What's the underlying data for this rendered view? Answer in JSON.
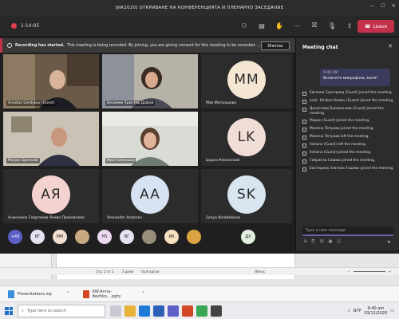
{
  "window": {
    "title": "[ИК2020] ОТКРИВАНЕ НА КОНФЕРЕНЦИЯТА И ПЛЕНАРНО ЗАСЕДАНИЕ"
  },
  "toolbar": {
    "timer": "1:14:05",
    "leave_label": "Leave"
  },
  "notice": {
    "bold": "Recording has started.",
    "text": "This meeting is being recorded. By joining, you are giving consent for this meeting to be recorded. ...",
    "dismiss_label": "Dismiss"
  },
  "tiles": [
    {
      "name": "Anastas Gerdjikov (Guest)"
    },
    {
      "name": "Весиеми Христов Дафов"
    },
    {
      "name": "Мая Митрашева",
      "initials": "MM",
      "color": "#f5e6d3"
    },
    {
      "name": "Marjan Gjurovski"
    },
    {
      "name": "Мил Сипонька"
    },
    {
      "name": "Църко Кеннеский",
      "initials": "LK",
      "color": "#f0ddd6"
    },
    {
      "name": "Анжелина Георгиева Янева Проковлева",
      "initials": "АЯ",
      "color": "#f3d2cf"
    },
    {
      "name": "Alexander Andonov",
      "initials": "AA",
      "color": "#d7e3f2"
    },
    {
      "name": "Sonya Karabelkova",
      "initials": "SK",
      "color": "#d8e5f0"
    }
  ],
  "strip": [
    {
      "label": "+40",
      "color": "#5b5fc7"
    },
    {
      "label": "ВГ",
      "color": "#e3e3f3"
    },
    {
      "label": "ММ",
      "color": "#f1dfd1"
    },
    {
      "label": "",
      "color": "#c9a882"
    },
    {
      "label": "HS",
      "color": "#ecd9f0"
    },
    {
      "label": "ВГ",
      "color": "#e3e3f3"
    },
    {
      "label": "",
      "color": "#9a8d7a"
    },
    {
      "label": "ИК",
      "color": "#f7e0bf"
    },
    {
      "label": "",
      "color": "#d9a441"
    },
    {
      "label": "ДХ",
      "color": "#e2efde"
    }
  ],
  "chat": {
    "title": "Meeting chat",
    "bubble_time": "9:40 AM",
    "bubble_text": "Включете микрофона, моля!",
    "events": [
      "Евгения Григорова (Guest) joined the meeting.",
      "assit. Kristian Kostov (Guest) joined the meeting.",
      "Десислава Басиманова (Guest) joined the meeting.",
      "Марин (Guest) joined the meeting.",
      "Милена Петрова joined the meeting.",
      "Милена Петрова left the meeting.",
      "Adriana (Guest) left the meeting.",
      "Adriana (Guest) joined the meeting.",
      "Габриела Савова joined the meeting.",
      "Екатерина Златева Тошева joined the meeting."
    ],
    "compose_placeholder": "Type a new message"
  },
  "word": {
    "status_page": "Стр. 2 от 2",
    "status_words": "3 думи",
    "status_lang": "български",
    "status_focus": "Фокус"
  },
  "downloads": [
    {
      "name": "Presentations.zip",
      "type": "zip"
    },
    {
      "name": "KW-Anna-Bezhko....pptx",
      "type": "ppt"
    }
  ],
  "taskbar": {
    "search_placeholder": "Type here to search",
    "lang": "БГР",
    "time": "9:40 am",
    "date": "03/12/2020"
  }
}
